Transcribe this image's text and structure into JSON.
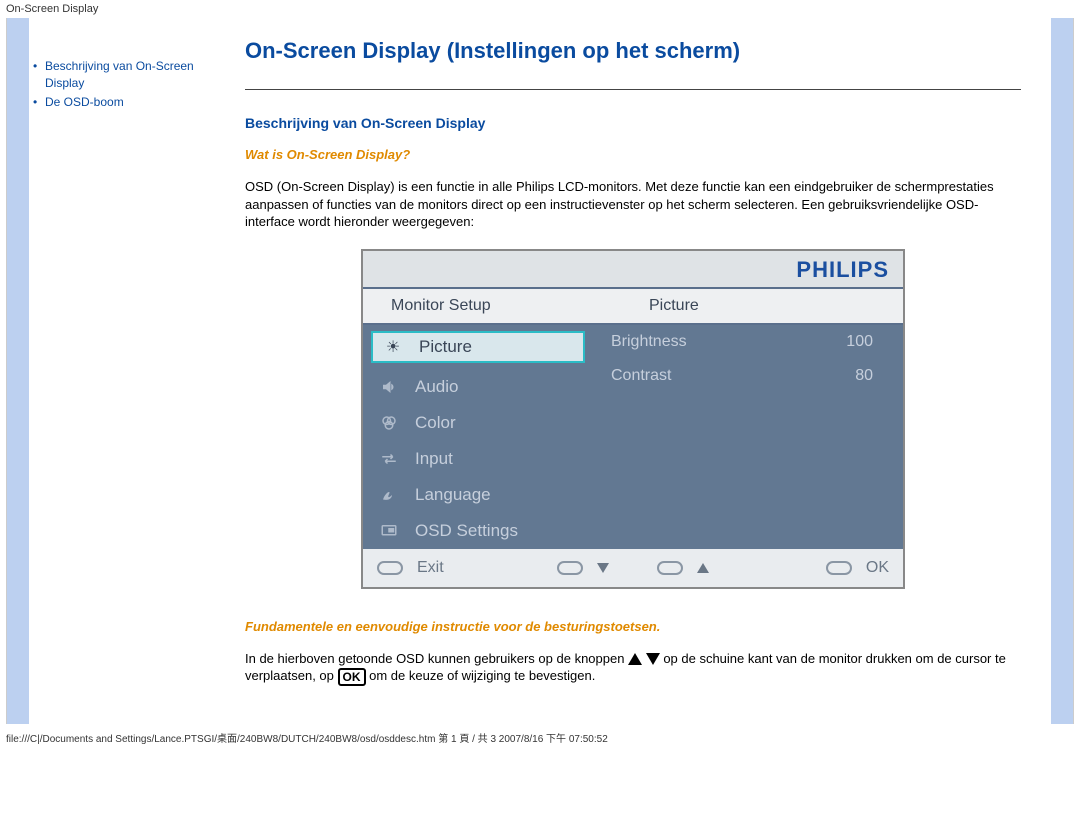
{
  "page_header": "On-Screen Display",
  "sidebar": {
    "items": [
      {
        "label": "Beschrijving van On-Screen Display"
      },
      {
        "label": "De OSD-boom"
      }
    ]
  },
  "main": {
    "title": "On-Screen Display (Instellingen op het scherm)",
    "section_heading": "Beschrijving van On-Screen Display",
    "subhead1": "Wat is On-Screen Display?",
    "para1": "OSD (On-Screen Display) is een functie in alle Philips LCD-monitors. Met deze functie kan een eindgebruiker de schermprestaties aanpassen of functies van de monitors direct op een instructievenster op het scherm selecteren. Een gebruiksvriendelijke OSD-interface wordt hieronder weergegeven:",
    "subhead2": "Fundamentele en eenvoudige instructie voor de besturingstoetsen.",
    "para2a": "In de hierboven getoonde OSD kunnen gebruikers op de knoppen ",
    "para2b": " op de schuine kant van de monitor drukken om de cursor te verplaatsen, op ",
    "para2c": " om de keuze of wijziging te bevestigen.",
    "ok_label": "OK"
  },
  "osd": {
    "brand": "PHILIPS",
    "header_left": "Monitor Setup",
    "header_right": "Picture",
    "left_menu": [
      {
        "icon": "sun",
        "label": "Picture",
        "selected": true
      },
      {
        "icon": "audio",
        "label": "Audio"
      },
      {
        "icon": "color",
        "label": "Color"
      },
      {
        "icon": "input",
        "label": "Input"
      },
      {
        "icon": "lang",
        "label": "Language"
      },
      {
        "icon": "osd",
        "label": "OSD Settings"
      }
    ],
    "right_menu": [
      {
        "label": "Brightness",
        "value": "100"
      },
      {
        "label": "Contrast",
        "value": "80"
      }
    ],
    "footer": {
      "exit": "Exit",
      "ok": "OK"
    }
  },
  "footer_file": "file:///C|/Documents and Settings/Lance.PTSGI/桌面/240BW8/DUTCH/240BW8/osd/osddesc.htm 第 1 頁 / 共 3 2007/8/16 下午 07:50:52"
}
